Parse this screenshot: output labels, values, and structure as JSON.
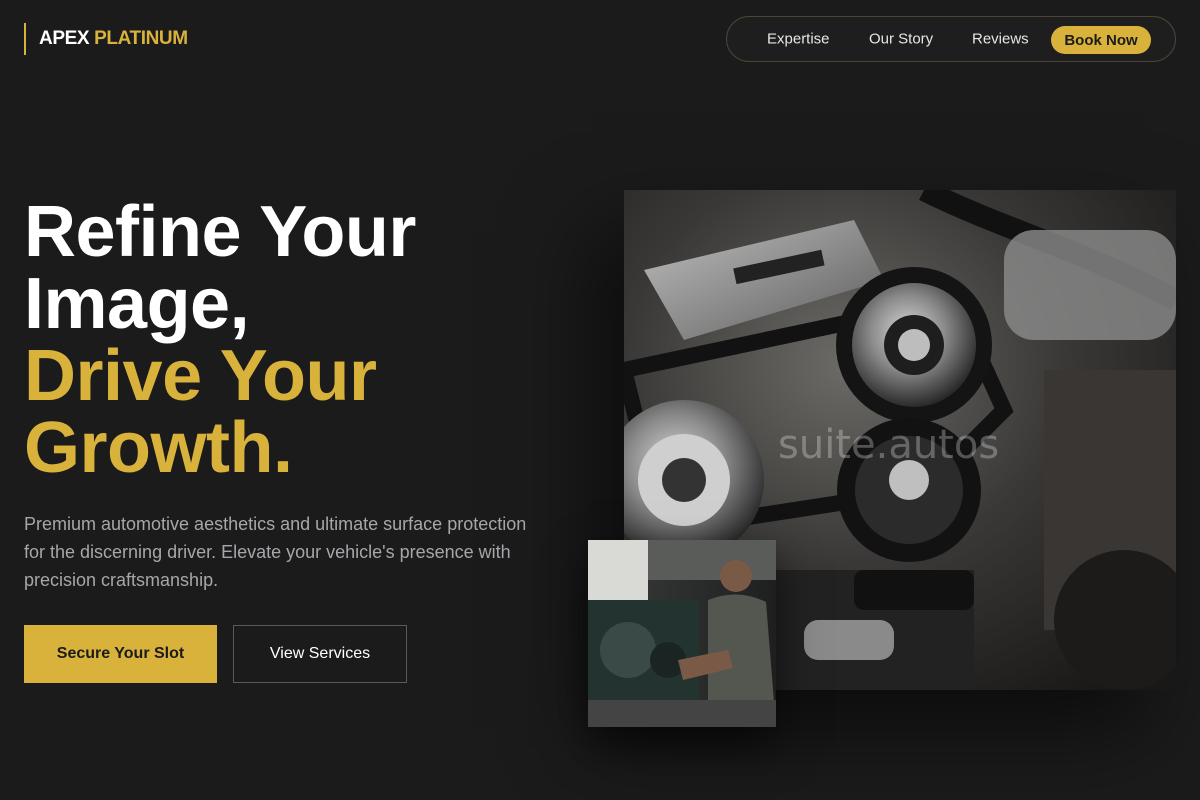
{
  "brand": {
    "part1": "APEX",
    "part2": "PLATINUM"
  },
  "nav": {
    "items": [
      {
        "label": "Expertise"
      },
      {
        "label": "Our Story"
      },
      {
        "label": "Reviews"
      }
    ],
    "cta": "Book Now"
  },
  "hero": {
    "headline_white": [
      "Refine Your",
      "Image,"
    ],
    "headline_gold": [
      "Drive Your",
      "Growth."
    ],
    "description": "Premium automotive aesthetics and ultimate surface protection for the discerning driver. Elevate your vehicle's presence with precision craftsmanship.",
    "primary_button": "Secure Your Slot",
    "secondary_button": "View Services"
  },
  "images": {
    "main_alt_watermark": "suite.autos"
  },
  "colors": {
    "background": "#1b1b1c",
    "accent": "#d9b23b",
    "text": "#ffffff",
    "muted_text": "#a7a7ab"
  }
}
